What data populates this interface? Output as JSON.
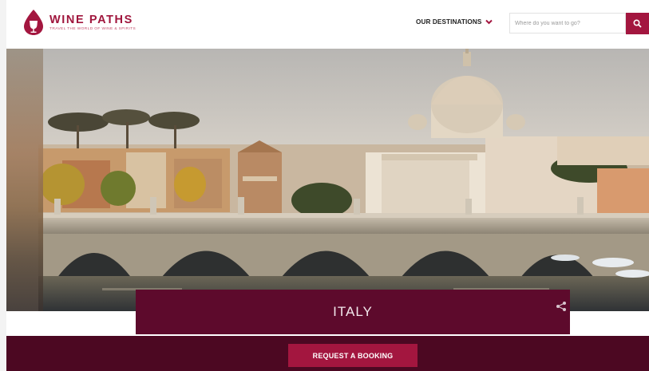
{
  "header": {
    "logo_title": "WINE PATHS",
    "logo_tagline": "TRAVEL THE WORLD OF WINE & SPIRITS",
    "destinations_label": "OUR DESTINATIONS",
    "search_placeholder": "Where do you want to go?"
  },
  "icons": {
    "logo": "wine-drop-icon",
    "destinations": "chevron-down-icon",
    "search": "search-icon",
    "share": "share-icon"
  },
  "hero": {
    "image_subject": "Rome cityscape with St. Peter's Basilica dome and Ponte Sant'Angelo bridge over the Tiber river"
  },
  "banner": {
    "title": "ITALY"
  },
  "footer": {
    "request_label": "REQUEST A BOOKING"
  },
  "colors": {
    "brand": "#a3163f",
    "banner": "#5d0a2c",
    "bottom_bar": "#4c0822"
  }
}
